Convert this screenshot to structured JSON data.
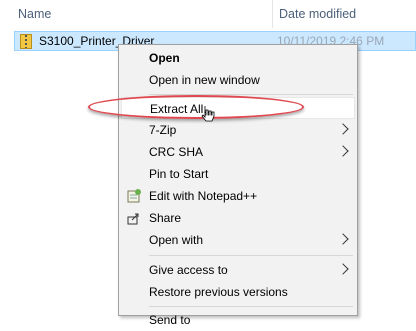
{
  "header": {
    "name_label": "Name",
    "date_label": "Date modified"
  },
  "file": {
    "name": "S3100_Printer_Driver",
    "date_modified": "10/11/2019 2:46 PM"
  },
  "context_menu": {
    "items": [
      {
        "label": "Open"
      },
      {
        "label": "Open in new window"
      },
      {
        "label": "Extract All..."
      },
      {
        "label": "7-Zip"
      },
      {
        "label": "CRC SHA"
      },
      {
        "label": "Pin to Start"
      },
      {
        "label": "Edit with Notepad++"
      },
      {
        "label": "Share"
      },
      {
        "label": "Open with"
      },
      {
        "label": "Give access to"
      },
      {
        "label": "Restore previous versions"
      },
      {
        "label": "Send to"
      }
    ]
  },
  "colors": {
    "selection_bg": "#cce8ff",
    "annotation": "#e0484f"
  },
  "icons": [
    "zip-folder-icon",
    "notepad-plus-plus-icon",
    "share-icon",
    "submenu-arrow-icon",
    "mouse-cursor-icon"
  ]
}
